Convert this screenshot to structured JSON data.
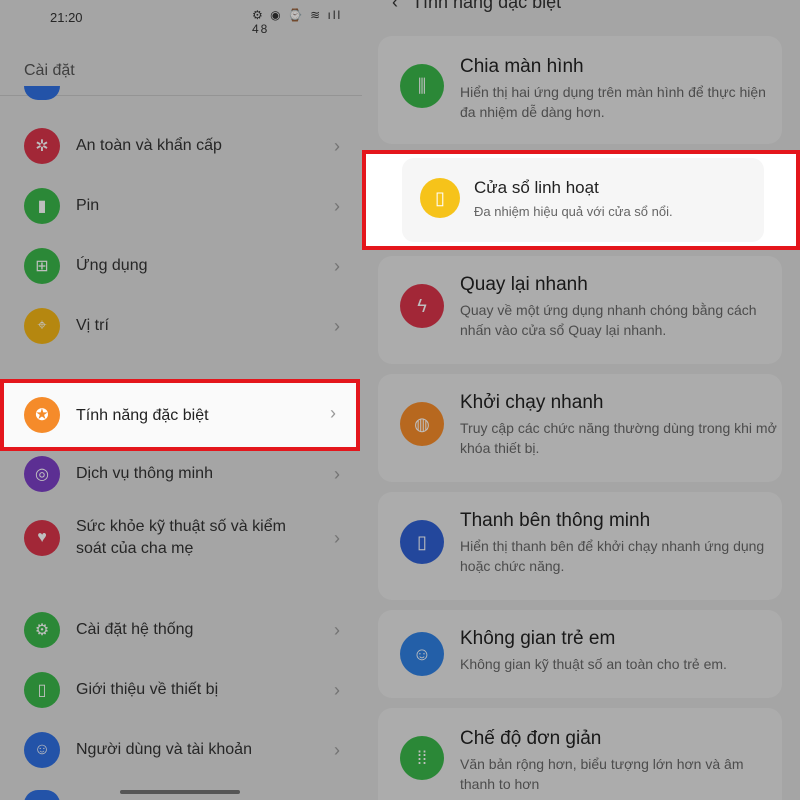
{
  "status_bar": {
    "time": "21:20",
    "icons": "⚙ ◉   ⌚ ≋ ıll 48"
  },
  "settings": {
    "title": "Cài đặt"
  },
  "left_items": [
    {
      "label": "An toàn và khẩn cấp",
      "icon": "asterisk-icon",
      "color": "#d8344a"
    },
    {
      "label": "Pin",
      "icon": "battery-icon",
      "color": "#3ab64a"
    },
    {
      "label": "Ứng dụng",
      "icon": "grid-icon",
      "color": "#3ab64a"
    },
    {
      "label": "Vị trí",
      "icon": "location-icon",
      "color": "#f2b516"
    },
    {
      "label": "Tính năng đặc biệt",
      "icon": "star-icon",
      "color": "#f58b2a"
    },
    {
      "label": "Dịch vụ thông minh",
      "icon": "smart-service-icon",
      "color": "#7b3fc4"
    },
    {
      "label": "Sức khỏe kỹ thuật số và kiểm soát của cha mẹ",
      "icon": "heart-icon",
      "color": "#d8344a"
    },
    {
      "label": "Cài đặt hệ thống",
      "icon": "gear-icon",
      "color": "#3ab64a"
    },
    {
      "label": "Giới thiệu về thiết bị",
      "icon": "phone-icon",
      "color": "#3ab64a"
    },
    {
      "label": "Người dùng và tài khoản",
      "icon": "user-icon",
      "color": "#2f6fe0"
    }
  ],
  "right": {
    "header": "Tính năng đặc biệt",
    "cards": [
      {
        "title": "Chia màn hình",
        "desc": "Hiển thị hai ứng dụng trên màn hình để thực hiện đa nhiệm dễ dàng hơn.",
        "icon": "split-screen-icon",
        "color": "#3ab64a"
      },
      {
        "title": "Cửa sổ linh hoạt",
        "desc": "Đa nhiệm hiệu quả với cửa sổ nổi.",
        "icon": "floating-window-icon",
        "color": "#f6c31a"
      },
      {
        "title": "Quay lại nhanh",
        "desc": "Quay về một ứng dụng nhanh chóng bằng cách nhấn vào cửa sổ Quay lại nhanh.",
        "icon": "lightning-icon",
        "color": "#d8344a"
      },
      {
        "title": "Khởi chạy nhanh",
        "desc": "Truy cập các chức năng thường dùng trong khi mở khóa thiết bị.",
        "icon": "fingerprint-icon",
        "color": "#f58b2a"
      },
      {
        "title": "Thanh bên thông minh",
        "desc": "Hiển thị thanh bên để khởi chạy nhanh ứng dụng hoặc chức năng.",
        "icon": "sidebar-icon",
        "color": "#2f5fd0"
      },
      {
        "title": "Không gian trẻ em",
        "desc": "Không gian kỹ thuật số an toàn cho trẻ em.",
        "icon": "kid-face-icon",
        "color": "#2f7fe0"
      },
      {
        "title": "Chế độ đơn giản",
        "desc": "Văn bản rộng hơn, biểu tượng lớn hơn và âm thanh to hơn",
        "icon": "simple-mode-icon",
        "color": "#3ab64a"
      }
    ]
  }
}
